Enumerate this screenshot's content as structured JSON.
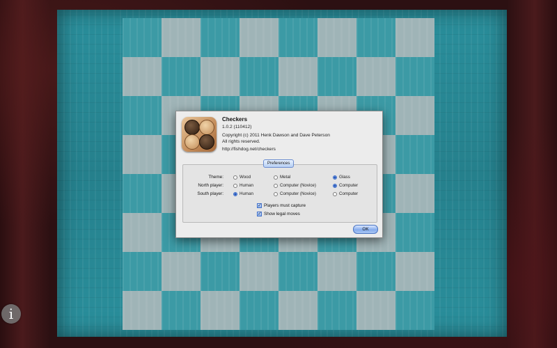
{
  "dialog": {
    "app_name": "Checkers",
    "version": "1.0.2 (110412)",
    "copyright": "Copyright (c) 2011 Henk Dawson and Dave Peterson",
    "rights": "All rights reserved.",
    "url": "http://fishdog.net/checkers",
    "ok_label": "OK"
  },
  "preferences": {
    "tab_label": "Preferences",
    "rows": [
      {
        "label": "Theme:",
        "options": [
          "Wood",
          "Metal",
          "Glass"
        ],
        "selected": 2
      },
      {
        "label": "North player:",
        "options": [
          "Human",
          "Computer (Novice)",
          "Computer"
        ],
        "selected": 2
      },
      {
        "label": "South player:",
        "options": [
          "Human",
          "Computer (Novice)",
          "Computer"
        ],
        "selected": 0
      }
    ],
    "players_must_capture": {
      "label": "Players must capture",
      "checked": true
    },
    "show_legal_moves": {
      "label": "Show legal moves",
      "checked": true
    }
  },
  "info_button": {
    "label": "i"
  },
  "colors": {
    "felt": "#2a8f9c",
    "frame": "#3a1416",
    "board_light": "#9fb4b7",
    "board_dark": "#3c9aa5"
  },
  "icons": {
    "info": "info-icon",
    "app": "checkers-app-icon"
  }
}
